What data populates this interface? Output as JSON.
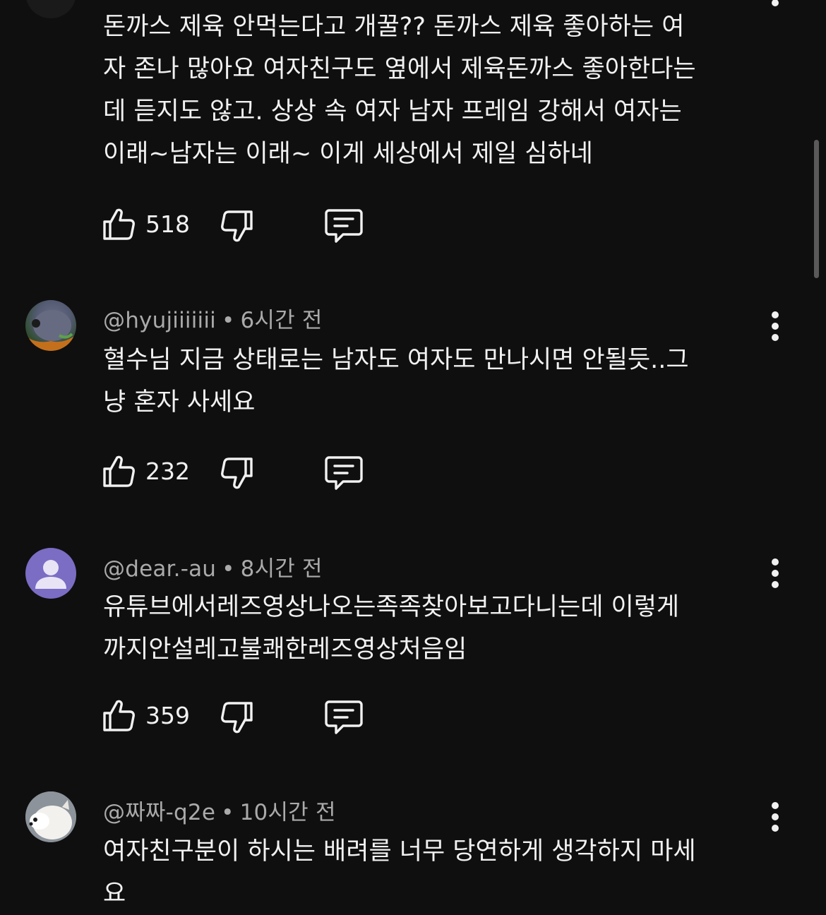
{
  "comments": [
    {
      "text": "돈까스 제육 안먹는다고 개꿀?? 돈까스 제육 좋아하는 여\n자 존나 많아요 여자친구도 옆에서 제육돈까스 좋아한다는\n데 듣지도 않고. 상상 속 여자 남자 프레임 강해서 여자는\n이래~남자는 이래~ 이게 세상에서 제일 심하네",
      "likes": "518"
    },
    {
      "handle": "@hyujiiiiiii",
      "time": "6시간 전",
      "text": "혈수님 지금 상태로는 남자도 여자도 만나시면 안될듯..그\n냥 혼자 사세요",
      "likes": "232"
    },
    {
      "handle": "@dear.-au",
      "time": "8시간 전",
      "text": "유튜브에서레즈영상나오는족족찾아보고다니는데 이렇게\n까지안설레고불쾌한레즈영상처음임",
      "likes": "359"
    },
    {
      "handle": "@짜짜-q2e",
      "time": "10시간 전",
      "text": "여자친구분이 하시는 배려를 너무 당연하게 생각하지 마세\n요"
    }
  ],
  "separator": "•",
  "colors": {
    "background": "#0f0f0f",
    "text": "#f1f1f1",
    "meta": "#aaaaaa",
    "default_avatar_bg": "#7b6cc4"
  }
}
